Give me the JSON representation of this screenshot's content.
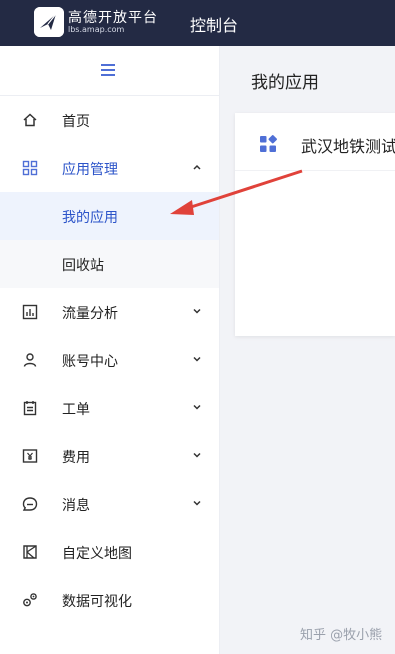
{
  "header": {
    "logo_text": "高德开放平台",
    "logo_domain": "lbs.amap.com",
    "console_label": "控制台"
  },
  "sidebar": {
    "toggle_icon": "hamburger-icon",
    "items": [
      {
        "label": "首页",
        "icon": "home-icon"
      },
      {
        "label": "应用管理",
        "icon": "grid-icon",
        "expanded": true,
        "children": [
          {
            "label": "我的应用",
            "selected": true
          },
          {
            "label": "回收站"
          }
        ]
      },
      {
        "label": "流量分析",
        "icon": "chart-icon"
      },
      {
        "label": "账号中心",
        "icon": "user-icon"
      },
      {
        "label": "工单",
        "icon": "clipboard-icon"
      },
      {
        "label": "费用",
        "icon": "yen-icon"
      },
      {
        "label": "消息",
        "icon": "message-icon"
      },
      {
        "label": "自定义地图",
        "icon": "map-icon"
      },
      {
        "label": "数据可视化",
        "icon": "visualization-icon"
      }
    ]
  },
  "main": {
    "title": "我的应用",
    "apps": [
      {
        "name": "武汉地铁测试",
        "icon": "app-grid-icon"
      }
    ]
  },
  "colors": {
    "topbar": "#232a44",
    "accent": "#2c54c9",
    "arrow": "#e0423a"
  },
  "watermark": "知乎 @牧小熊"
}
